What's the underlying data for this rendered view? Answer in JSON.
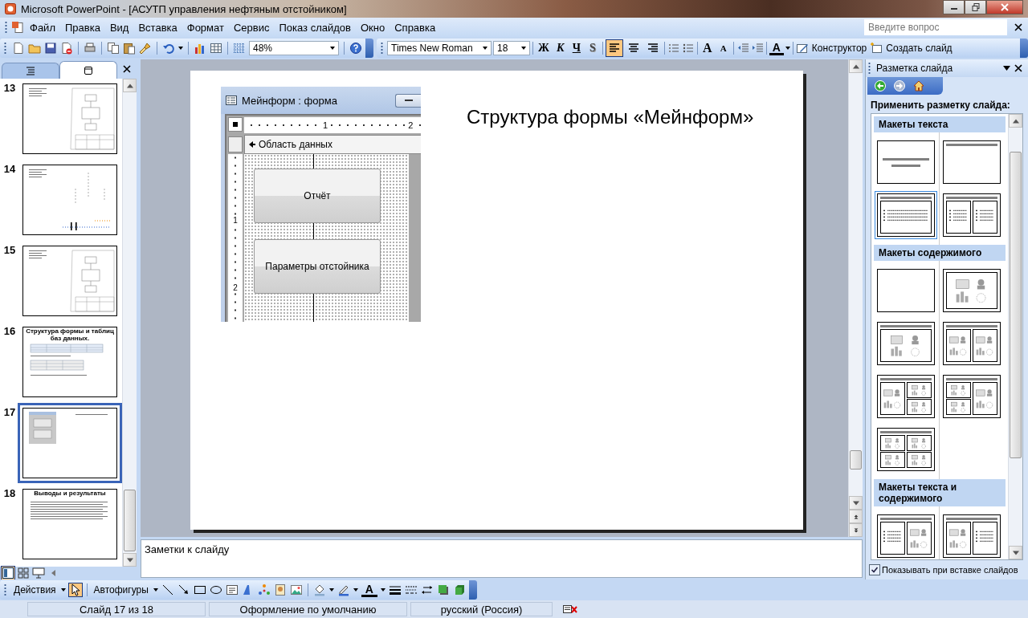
{
  "window": {
    "title": "Microsoft PowerPoint - [АСУТП управления нефтяным отстойником]"
  },
  "menu": [
    {
      "label": "Файл"
    },
    {
      "label": "Правка"
    },
    {
      "label": "Вид"
    },
    {
      "label": "Вставка"
    },
    {
      "label": "Формат"
    },
    {
      "label": "Сервис"
    },
    {
      "label": "Показ слайдов"
    },
    {
      "label": "Окно"
    },
    {
      "label": "Справка"
    }
  ],
  "help_search": {
    "placeholder": "Введите вопрос"
  },
  "standard_toolbar": {
    "zoom": "48%"
  },
  "format_toolbar": {
    "font": "Times New Roman",
    "size": "18",
    "bold": "Ж",
    "italic": "К",
    "underline": "Ч",
    "shadow": "S",
    "align": [
      {
        "kind": "left",
        "selected": true
      },
      {
        "kind": "center",
        "selected": false
      },
      {
        "kind": "right",
        "selected": false
      }
    ],
    "grow_font": "A",
    "shrink_font": "A",
    "font_color": "A",
    "designer": "Конструктор",
    "new_slide": "Создать слайд"
  },
  "slides_pane": {
    "tabs": [
      {
        "kind": "outline",
        "selected": false
      },
      {
        "kind": "slides",
        "selected": true
      }
    ],
    "slides": [
      {
        "number": "13",
        "kind": "diagram",
        "selected": false
      },
      {
        "number": "14",
        "kind": "scheme",
        "selected": false
      },
      {
        "number": "15",
        "kind": "diagram",
        "selected": false
      },
      {
        "number": "16",
        "kind": "tables",
        "title": "Структура формы и таблиц баз данных.",
        "selected": false
      },
      {
        "number": "17",
        "kind": "form",
        "selected": true
      },
      {
        "number": "18",
        "kind": "text",
        "title": "Выводы и результаты",
        "selected": false
      }
    ]
  },
  "slide": {
    "title": "Структура формы «Мейнформ»",
    "form": {
      "title": "Мейнформ : форма",
      "ruler_marks": [
        "1",
        "2"
      ],
      "section": "Область данных",
      "buttons": [
        "Отчёт",
        "Параметры отстойника"
      ],
      "side_marks": [
        "1",
        "2"
      ]
    }
  },
  "notes": {
    "placeholder": "Заметки к слайду"
  },
  "task_pane": {
    "title": "Разметка слайда",
    "heading": "Применить разметку слайда:",
    "groups": [
      {
        "title": "Макеты текста",
        "layouts": [
          {
            "kind": "title",
            "selected": false
          },
          {
            "kind": "title-only",
            "selected": false
          },
          {
            "kind": "title-text",
            "selected": true
          },
          {
            "kind": "two-text",
            "selected": false
          }
        ]
      },
      {
        "title": "Макеты содержимого",
        "layouts": [
          {
            "kind": "blank",
            "selected": false
          },
          {
            "kind": "content",
            "selected": false
          },
          {
            "kind": "title-content",
            "selected": false
          },
          {
            "kind": "title-two-content",
            "selected": false
          },
          {
            "kind": "content-two-small",
            "selected": false
          },
          {
            "kind": "two-small-content",
            "selected": false
          },
          {
            "kind": "four-content",
            "selected": false
          }
        ]
      },
      {
        "title": "Макеты текста и содержимого",
        "layouts": [
          {
            "kind": "text-content",
            "selected": false
          },
          {
            "kind": "content-text",
            "selected": false
          }
        ]
      }
    ],
    "show_on_insert": {
      "label": "Показывать при вставке слайдов",
      "checked": true
    }
  },
  "drawing_toolbar": {
    "actions": "Действия",
    "autoshapes": "Автофигуры",
    "font_color": "A"
  },
  "status_bar": [
    "Слайд 17 из 18",
    "Оформление по умолчанию",
    "русский (Россия)"
  ]
}
